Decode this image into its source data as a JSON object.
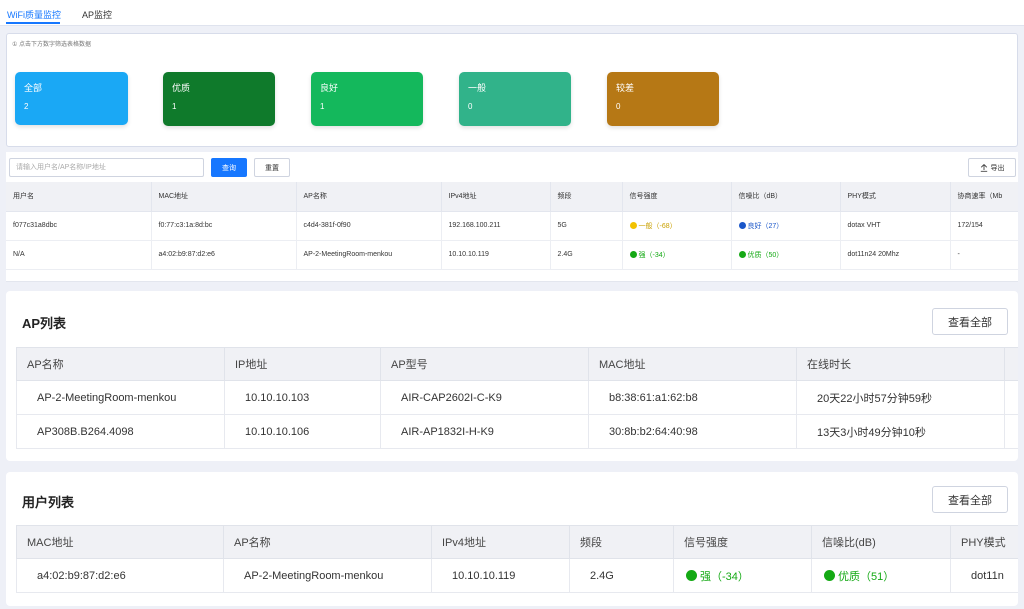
{
  "tabs": [
    {
      "label": "WiFi质量监控",
      "active": true
    },
    {
      "label": "AP监控",
      "active": false
    }
  ],
  "summary": {
    "hint": "① 点击下方数字筛选表格数据",
    "cards": [
      {
        "label": "全部",
        "count": "2",
        "color": "#1aa8f5"
      },
      {
        "label": "优质",
        "count": "1",
        "color": "#0f7a2b"
      },
      {
        "label": "良好",
        "count": "1",
        "color": "#14b85c"
      },
      {
        "label": "一般",
        "count": "0",
        "color": "#31b38a"
      },
      {
        "label": "较差",
        "count": "0",
        "color": "#b67815"
      }
    ]
  },
  "toolbar": {
    "search_placeholder": "请输入用户名/AP名称/IP地址",
    "query_label": "查询",
    "reset_label": "重置",
    "export_label": "导出"
  },
  "quality_table": {
    "headers": [
      "用户名",
      "MAC地址",
      "AP名称",
      "IPv4地址",
      "频段",
      "信号强度",
      "信噪比（dB）",
      "PHY模式",
      "协商速率（Mb"
    ],
    "rows": [
      {
        "user": "f077c31a8dbc",
        "mac": "f0:77:c3:1a:8d:bc",
        "ap": "c4d4-381f-0f90",
        "ipv4": "192.168.100.211",
        "band": "5G",
        "signal": "一般（-68）",
        "signal_color": "#f2c200",
        "snr": "良好（27）",
        "snr_color": "#1a56c9",
        "phy": "dotax VHT",
        "rate": "172/154"
      },
      {
        "user": "N/A",
        "mac": "a4:02:b9:87:d2:e6",
        "ap": "AP-2-MeetingRoom-menkou",
        "ipv4": "10.10.10.119",
        "band": "2.4G",
        "signal": "强（-34）",
        "signal_color": "#14a914",
        "snr": "优质（50）",
        "snr_color": "#14a914",
        "phy": "dot11n24 20Mhz",
        "rate": "-"
      }
    ]
  },
  "ap_list": {
    "title": "AP列表",
    "view_all_label": "查看全部",
    "headers": [
      "AP名称",
      "IP地址",
      "AP型号",
      "MAC地址",
      "在线时长"
    ],
    "rows": [
      [
        "AP-2-MeetingRoom-menkou",
        "10.10.10.103",
        "AIR-CAP2602I-C-K9",
        "b8:38:61:a1:62:b8",
        "20天22小时57分钟59秒"
      ],
      [
        "AP308B.B264.4098",
        "10.10.10.106",
        "AIR-AP1832I-H-K9",
        "30:8b:b2:64:40:98",
        "13天3小时49分钟10秒"
      ]
    ]
  },
  "user_list": {
    "title": "用户列表",
    "view_all_label": "查看全部",
    "headers": [
      "MAC地址",
      "AP名称",
      "IPv4地址",
      "频段",
      "信号强度",
      "信噪比(dB)",
      "PHY模式"
    ],
    "rows": [
      {
        "mac": "a4:02:b9:87:d2:e6",
        "ap": "AP-2-MeetingRoom-menkou",
        "ipv4": "10.10.10.119",
        "band": "2.4G",
        "signal": "强（-34）",
        "signal_color": "#14a914",
        "snr": "优质（51）",
        "snr_color": "#14a914",
        "phy": "dot11n"
      }
    ]
  }
}
